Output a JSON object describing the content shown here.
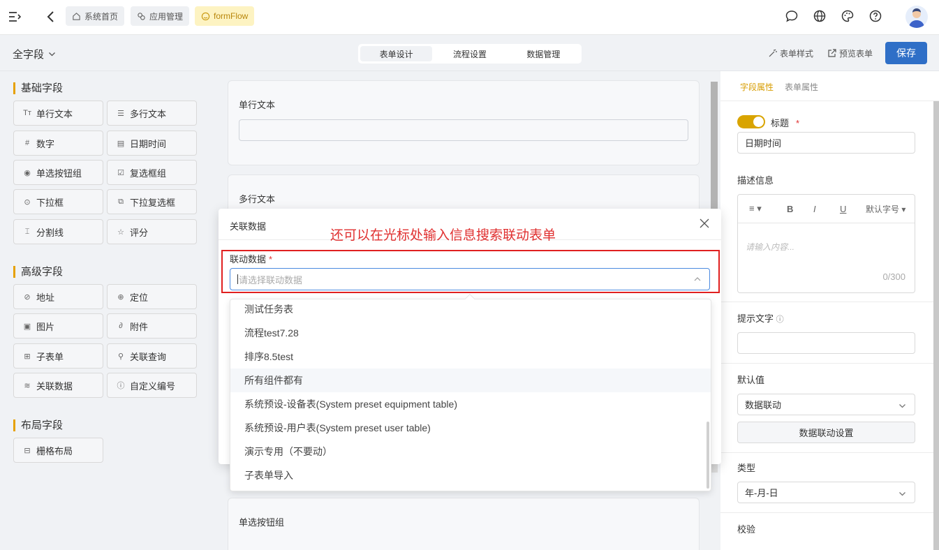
{
  "topbar": {
    "breadcrumbs": [
      {
        "label": "系统首页",
        "icon": "home-icon"
      },
      {
        "label": "应用管理",
        "icon": "apps-icon"
      },
      {
        "label": "formFlow",
        "icon": "smile-icon"
      }
    ],
    "icons": [
      "chat-icon",
      "globe-icon",
      "palette-icon",
      "help-icon",
      "avatar"
    ]
  },
  "subbar": {
    "field_scope": "全字段",
    "tabs": [
      "表单设计",
      "流程设置",
      "数据管理"
    ],
    "active_tab": "表单设计",
    "form_style": "表单样式",
    "preview": "预览表单",
    "save": "保存"
  },
  "left": {
    "groups": [
      {
        "title": "基础字段",
        "items": [
          {
            "label": "单行文本",
            "icon": "text-icon"
          },
          {
            "label": "多行文本",
            "icon": "multiline-icon"
          },
          {
            "label": "数字",
            "icon": "hash-icon"
          },
          {
            "label": "日期时间",
            "icon": "calendar-icon"
          },
          {
            "label": "单选按钮组",
            "icon": "radio-icon"
          },
          {
            "label": "复选框组",
            "icon": "checkbox-icon"
          },
          {
            "label": "下拉框",
            "icon": "select-icon"
          },
          {
            "label": "下拉复选框",
            "icon": "multiselect-icon"
          },
          {
            "label": "分割线",
            "icon": "divider-icon"
          },
          {
            "label": "评分",
            "icon": "star-icon"
          }
        ]
      },
      {
        "title": "高级字段",
        "items": [
          {
            "label": "地址",
            "icon": "compass-icon"
          },
          {
            "label": "定位",
            "icon": "location-icon"
          },
          {
            "label": "图片",
            "icon": "image-icon"
          },
          {
            "label": "附件",
            "icon": "paperclip-icon"
          },
          {
            "label": "子表单",
            "icon": "table-icon"
          },
          {
            "label": "关联查询",
            "icon": "search-icon"
          },
          {
            "label": "关联数据",
            "icon": "database-icon"
          },
          {
            "label": "自定义编号",
            "icon": "info-icon"
          }
        ]
      },
      {
        "title": "布局字段",
        "items": [
          {
            "label": "栅格布局",
            "icon": "grid-icon"
          }
        ]
      }
    ]
  },
  "canvas": {
    "cards": [
      {
        "label": "单行文本"
      },
      {
        "label": "多行文本"
      },
      {
        "label": "单选按钮组"
      }
    ]
  },
  "right": {
    "tabs": [
      "字段属性",
      "表单属性"
    ],
    "title_label": "标题",
    "title_value": "日期时间",
    "desc_label": "描述信息",
    "editor_font": "默认字号",
    "editor_placeholder": "请输入内容...",
    "editor_count": "0/300",
    "hint_label": "提示文字",
    "default_label": "默认值",
    "default_value": "数据联动",
    "linkage_button": "数据联动设置",
    "type_label": "类型",
    "type_value": "年-月-日",
    "validate_label": "校验"
  },
  "modal": {
    "title": "关联数据",
    "annotation": "还可以在光标处输入信息搜索联动表单",
    "field_label": "联动数据",
    "placeholder": "请选择联动数据",
    "options": [
      "测试任务表",
      "流程test7.28",
      "排序8.5test",
      "所有组件都有",
      "系统预设-设备表(System preset equipment table)",
      "系统预设-用户表(System preset user table)",
      "演示专用（不要动）",
      "子表单导入"
    ],
    "hovered_option": "所有组件都有"
  },
  "colors": {
    "accent": "#d9a400",
    "primary": "#2f6fc7",
    "annotation": "#e03030"
  }
}
